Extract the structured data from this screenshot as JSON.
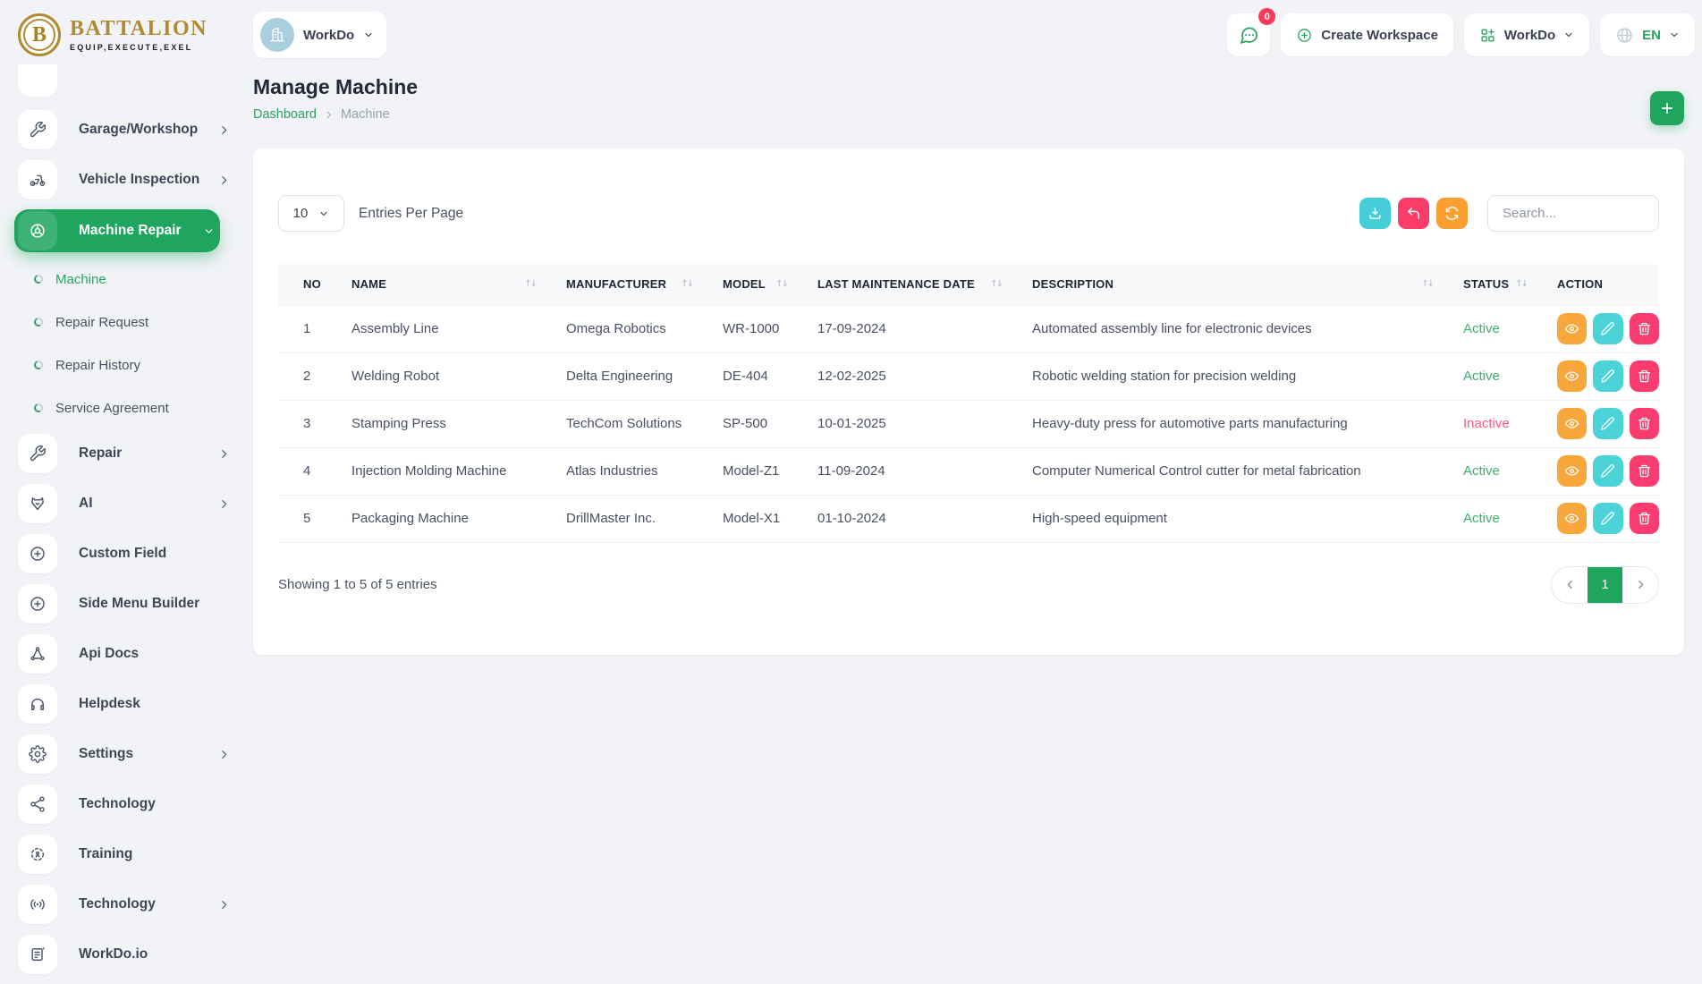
{
  "brand": {
    "name": "BATTALION",
    "initial": "B",
    "tagline": "EQUIP,EXECUTE,EXEL"
  },
  "topbar": {
    "workspace_selector": {
      "label": "WorkDo",
      "avatar_icon": "building-icon"
    },
    "chat_badge": "0",
    "create_workspace_label": "Create Workspace",
    "workspace_menu_label": "WorkDo",
    "language_label": "EN"
  },
  "sidebar": {
    "items": [
      {
        "label": "Garage/Workshop",
        "icon": "wrench-icon",
        "chevron": "right"
      },
      {
        "label": "Vehicle Inspection",
        "icon": "motorcycle-icon",
        "chevron": "right"
      },
      {
        "label": "Machine Repair",
        "icon": "machine-wheel-icon",
        "chevron": "down",
        "active": true
      },
      {
        "label": "Repair",
        "icon": "wrench-icon",
        "chevron": "right"
      },
      {
        "label": "AI",
        "icon": "ai-fox-icon",
        "chevron": "right"
      },
      {
        "label": "Custom Field",
        "icon": "plus-circle-icon"
      },
      {
        "label": "Side Menu Builder",
        "icon": "plus-circle-icon"
      },
      {
        "label": "Api Docs",
        "icon": "api-nodes-icon"
      },
      {
        "label": "Helpdesk",
        "icon": "headphones-icon"
      },
      {
        "label": "Settings",
        "icon": "gear-icon",
        "chevron": "right"
      },
      {
        "label": "Technology",
        "icon": "share-nodes-icon"
      },
      {
        "label": "Training",
        "icon": "focus-dashed-icon"
      },
      {
        "label": "Technology",
        "icon": "broadcast-icon",
        "chevron": "right"
      },
      {
        "label": "WorkDo.io",
        "icon": "document-icon"
      }
    ],
    "machine_repair_children": [
      {
        "label": "Machine",
        "active": true
      },
      {
        "label": "Repair Request"
      },
      {
        "label": "Repair History"
      },
      {
        "label": "Service Agreement"
      }
    ]
  },
  "page": {
    "title": "Manage Machine",
    "breadcrumb": {
      "home": "Dashboard",
      "current": "Machine"
    }
  },
  "toolbar": {
    "entries_value": "10",
    "entries_label": "Entries Per Page",
    "search_placeholder": "Search...",
    "buttons": [
      {
        "icon": "download-icon",
        "color": "#45cdd8"
      },
      {
        "icon": "undo-icon",
        "color": "#fb3b68"
      },
      {
        "icon": "refresh-icon",
        "color": "#fba030"
      }
    ]
  },
  "table": {
    "headers": [
      "NO",
      "NAME",
      "MANUFACTURER",
      "MODEL",
      "LAST MAINTENANCE DATE",
      "DESCRIPTION",
      "STATUS",
      "ACTION"
    ],
    "rows": [
      {
        "no": "1",
        "name": "Assembly Line",
        "manufacturer": "Omega Robotics",
        "model": "WR-1000",
        "date": "17-09-2024",
        "description": "Automated assembly line for electronic devices",
        "status": "Active"
      },
      {
        "no": "2",
        "name": "Welding Robot",
        "manufacturer": "Delta Engineering",
        "model": "DE-404",
        "date": "12-02-2025",
        "description": "Robotic welding station for precision welding",
        "status": "Active"
      },
      {
        "no": "3",
        "name": "Stamping Press",
        "manufacturer": "TechCom Solutions",
        "model": "SP-500",
        "date": "10-01-2025",
        "description": "Heavy-duty press for automotive parts manufacturing",
        "status": "Inactive"
      },
      {
        "no": "4",
        "name": "Injection Molding Machine",
        "manufacturer": "Atlas Industries",
        "model": "Model-Z1",
        "date": "11-09-2024",
        "description": "Computer Numerical Control cutter for metal fabrication",
        "status": "Active"
      },
      {
        "no": "5",
        "name": "Packaging Machine",
        "manufacturer": "DrillMaster Inc.",
        "model": "Model-X1",
        "date": "01-10-2024",
        "description": "High-speed equipment",
        "status": "Active"
      }
    ],
    "row_action_icons": [
      "eye-icon",
      "pencil-icon",
      "trash-icon"
    ],
    "footer_text": "Showing 1 to 5 of 5 entries",
    "page_number": "1"
  },
  "colors": {
    "accent_green": "#1fa55e",
    "status_active": "#39b26d",
    "status_inactive": "#f75c81",
    "view_orange": "#f9a63b",
    "edit_cyan": "#4bd3d8",
    "delete_pink": "#fa3d6e",
    "badge_red": "#fb3b5c",
    "gold": "#b08a2e",
    "page_bg": "#f1f3f6"
  }
}
